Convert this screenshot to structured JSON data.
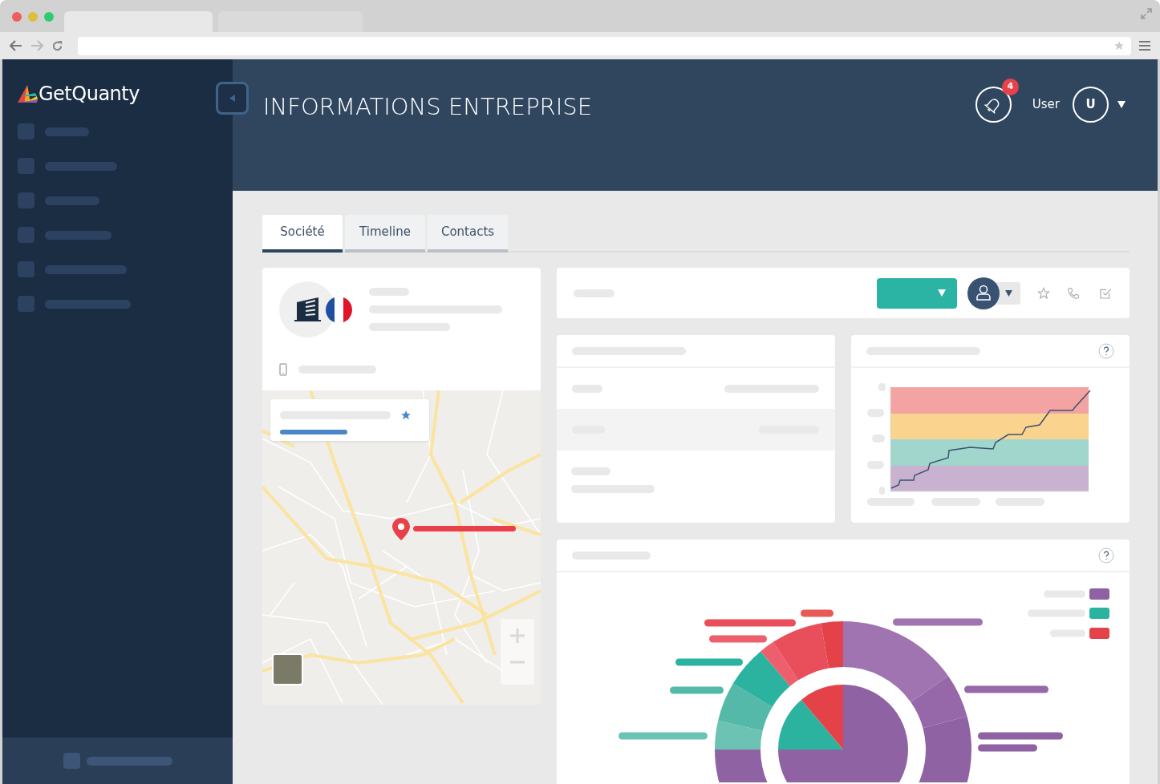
{
  "logo": {
    "text": "GetQuanty"
  },
  "header": {
    "title": "INFORMATIONS ENTREPRISE",
    "notification_count": "4",
    "user_label": "User",
    "avatar_initial": "U"
  },
  "tabs": [
    {
      "label": "Société",
      "selected": true
    },
    {
      "label": "Timeline",
      "selected": false
    },
    {
      "label": "Contacts",
      "selected": false
    }
  ]
}
